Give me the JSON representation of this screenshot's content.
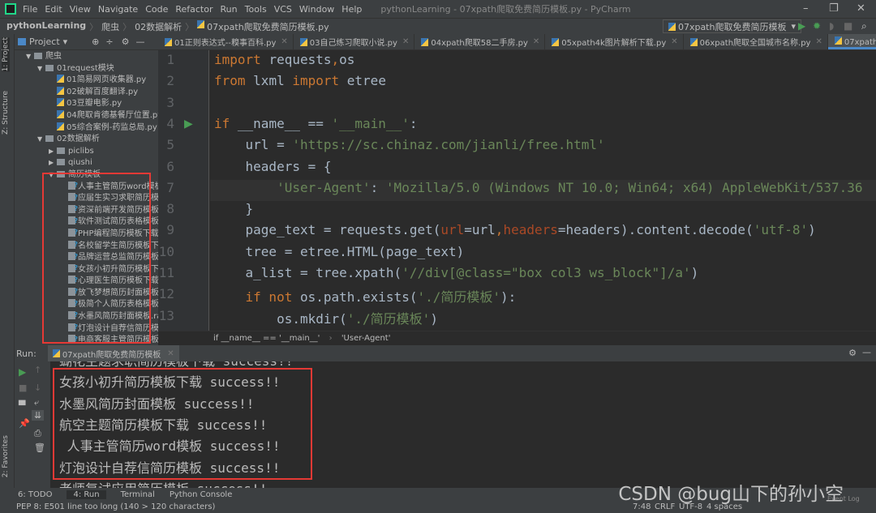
{
  "menubar": {
    "items": [
      "File",
      "Edit",
      "View",
      "Navigate",
      "Code",
      "Refactor",
      "Run",
      "Tools",
      "VCS",
      "Window",
      "Help"
    ],
    "window_title": "pythonLearning - 07xpath爬取免费简历模板.py - PyCharm"
  },
  "navbar": {
    "breadcrumb": [
      "pythonLearning",
      "爬虫",
      "02数据解析",
      "07xpath爬取免费简历模板.py"
    ],
    "run_config": "07xpath爬取免费简历模板"
  },
  "project": {
    "title": "Project",
    "tree": [
      {
        "label": "爬虫",
        "type": "folder",
        "depth": 0,
        "open": true
      },
      {
        "label": "01request模块",
        "type": "folder",
        "depth": 1,
        "open": true
      },
      {
        "label": "01简易网页收集器.py",
        "type": "py",
        "depth": 2
      },
      {
        "label": "02破解百度翻译.py",
        "type": "py",
        "depth": 2
      },
      {
        "label": "03豆瓣电影.py",
        "type": "py",
        "depth": 2
      },
      {
        "label": "04爬取肯德基餐厅位置.py",
        "type": "py",
        "depth": 2
      },
      {
        "label": "05综合案例-药监总局.py",
        "type": "py",
        "depth": 2
      },
      {
        "label": "02数据解析",
        "type": "folder",
        "depth": 1,
        "open": true
      },
      {
        "label": "piclibs",
        "type": "folder",
        "depth": 2,
        "open": false
      },
      {
        "label": "qiushi",
        "type": "folder",
        "depth": 2,
        "open": false
      },
      {
        "label": "简历模板",
        "type": "folder",
        "depth": 2,
        "open": true
      },
      {
        "label": "人事主管简历word模板.rar",
        "type": "unk",
        "depth": 3
      },
      {
        "label": "应届生实习求职简历模板.rar",
        "type": "unk",
        "depth": 3
      },
      {
        "label": "资深前端开发简历模板下载.rar",
        "type": "unk",
        "depth": 3
      },
      {
        "label": "软件测试简历表格模板.rar",
        "type": "unk",
        "depth": 3
      },
      {
        "label": "PHP编程简历模板下载.rar",
        "type": "unk",
        "depth": 3
      },
      {
        "label": "名校留学生简历模板下载.rar",
        "type": "unk",
        "depth": 3
      },
      {
        "label": "品牌运营总监简历模板下载.rar",
        "type": "unk",
        "depth": 3
      },
      {
        "label": "女孩小初升简历模板下载.rar",
        "type": "unk",
        "depth": 3
      },
      {
        "label": "心理医生简历模板下载.rar",
        "type": "unk",
        "depth": 3
      },
      {
        "label": "放飞梦想简历封面模板.rar",
        "type": "unk",
        "depth": 3
      },
      {
        "label": "极简个人简历表格模板.rar",
        "type": "unk",
        "depth": 3
      },
      {
        "label": "水墨风简历封面模板.rar",
        "type": "unk",
        "depth": 3
      },
      {
        "label": "灯泡设计自荐信简历模板.rar",
        "type": "unk",
        "depth": 3
      },
      {
        "label": "电商客服主管简历模板.rar",
        "type": "unk",
        "depth": 3
      }
    ]
  },
  "tabs": [
    {
      "label": "01正则表达式--糗事百科.py",
      "active": false
    },
    {
      "label": "03自己练习爬取小说.py",
      "active": false
    },
    {
      "label": "04xpath爬取58二手房.py",
      "active": false
    },
    {
      "label": "05xpath4k图片解析下载.py",
      "active": false
    },
    {
      "label": "06xpath爬取全国城市名称.py",
      "active": false
    },
    {
      "label": "07xpath爬取免费简历模板.py",
      "active": true
    }
  ],
  "editor": {
    "lines": [
      [
        [
          "kw",
          "import "
        ],
        [
          "",
          "requests"
        ],
        [
          "kw",
          ","
        ],
        [
          "",
          "os"
        ]
      ],
      [
        [
          "kw",
          "from "
        ],
        [
          "",
          "lxml "
        ],
        [
          "kw",
          "import "
        ],
        [
          "",
          "etree"
        ]
      ],
      [],
      [
        [
          "kw",
          "if "
        ],
        [
          "",
          "__name__ == "
        ],
        [
          "st",
          "'__main__'"
        ],
        [
          "",
          ":"
        ]
      ],
      [
        [
          "",
          "    url = "
        ],
        [
          "st",
          "'https://sc.chinaz.com/jianli/free.html'"
        ]
      ],
      [
        [
          "",
          "    headers = {"
        ]
      ],
      [
        [
          "",
          "        "
        ],
        [
          "st",
          "'User-Agent'"
        ],
        [
          "",
          ": "
        ],
        [
          "st",
          "'Mozilla/5.0 (Windows NT 10.0; Win64; x64) AppleWebKit/537.36"
        ]
      ],
      [
        [
          "",
          "    }"
        ]
      ],
      [
        [
          "",
          "    page_text = requests.get("
        ],
        [
          "pa",
          "url"
        ],
        [
          "",
          "=url"
        ],
        [
          "kw",
          ","
        ],
        [
          "pa",
          "headers"
        ],
        [
          "",
          "=headers).content.decode("
        ],
        [
          "st",
          "'utf-8'"
        ],
        [
          "",
          ")"
        ]
      ],
      [
        [
          "",
          "    tree = etree.HTML(page_text)"
        ]
      ],
      [
        [
          "",
          "    a_list = tree.xpath("
        ],
        [
          "st",
          "'//div[@class=\"box col3 ws_block\"]/a'"
        ],
        [
          "",
          ")"
        ]
      ],
      [
        [
          "",
          "    "
        ],
        [
          "kw",
          "if not "
        ],
        [
          "",
          "os.path.exists("
        ],
        [
          "st",
          "'./简历模板'"
        ],
        [
          "",
          "):"
        ]
      ],
      [
        [
          "",
          "        os.mkdir("
        ],
        [
          "st",
          "'./简历模板'"
        ],
        [
          "",
          ")"
        ]
      ]
    ],
    "current_line": 7,
    "breadcrumb": [
      "if __name__ == '__main__'",
      "'User-Agent'"
    ]
  },
  "run": {
    "label": "Run:",
    "tab": "07xpath爬取免费简历模板",
    "output": [
      "蝴花主题求职简历模板下载 success!!",
      "女孩小初升简历模板下载 success!!",
      "水墨风简历封面模板 success!!",
      "航空主题简历模板下载 success!!",
      " 人事主管简历word模板 success!!",
      "灯泡设计自荐信简历模板 success!!",
      "老师复试应用简历模板 success!!"
    ]
  },
  "bottom_tabs": [
    {
      "label": "6: TODO"
    },
    {
      "label": "4: Run",
      "active": true
    },
    {
      "label": "Terminal"
    },
    {
      "label": "Python Console"
    }
  ],
  "left_stripe": [
    "1: Project",
    "Z: Structure",
    "2: Favorites"
  ],
  "status": {
    "message": "PEP 8: E501 line too long (140 > 120 characters)",
    "position": "7:48",
    "line_sep": "CRLF",
    "encoding": "UTF-8",
    "indent": "4 spaces",
    "event_log": "Event Log"
  },
  "watermark": "CSDN @bug山下的孙小空",
  "colors": {
    "keyword": "#cc7832",
    "string": "#6a8759",
    "text": "#a9b7c6",
    "highlight_box": "#e53935",
    "run_green": "#499c54"
  }
}
